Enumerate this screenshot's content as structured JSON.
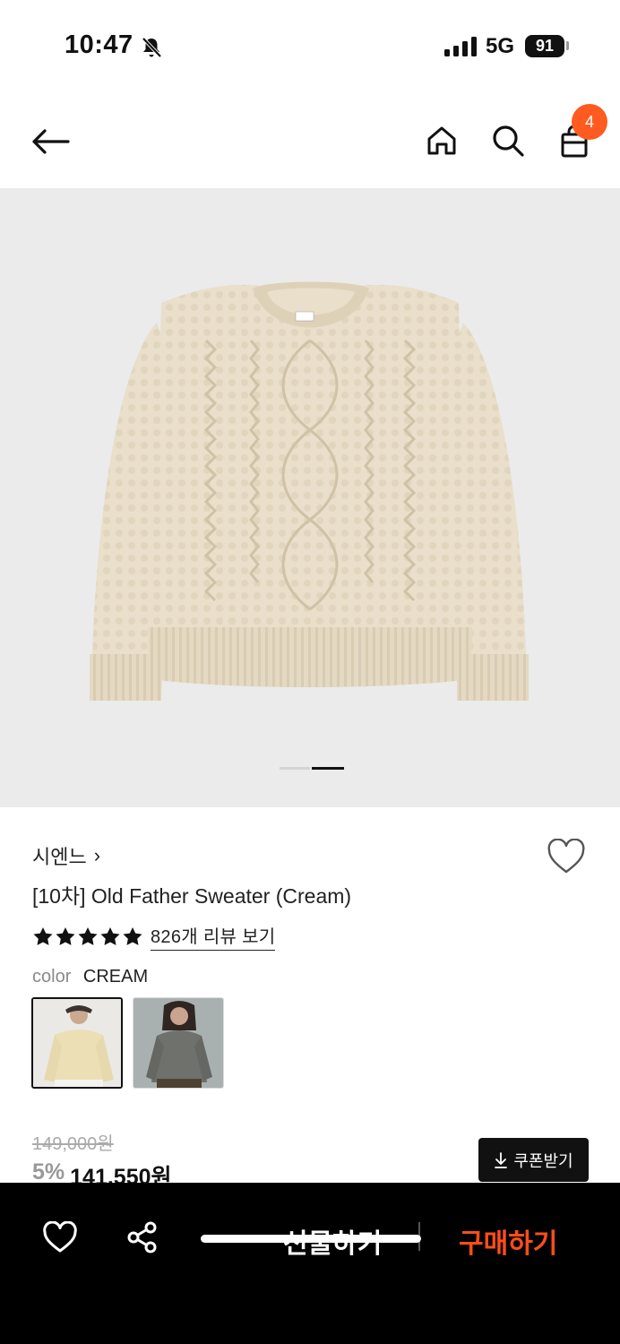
{
  "status_bar": {
    "time": "10:47",
    "network": "5G",
    "battery": "91"
  },
  "header": {
    "cart_count": "4"
  },
  "product": {
    "brand": "시엔느",
    "brand_chevron": "›",
    "title": "[10차] Old Father Sweater (Cream)",
    "rating_stars": 5,
    "reviews_link": "826개 리뷰 보기",
    "color_label": "color",
    "color_value": "CREAM",
    "original_price": "149,000원",
    "discount": "5%",
    "sale_price": "141,550원",
    "coupon_button": "쿠폰받기"
  },
  "carousel": {
    "slides": 2,
    "active": 2
  },
  "bottom_bar": {
    "gift_label": "선물하기",
    "buy_label": "구매하기"
  },
  "colors": {
    "accent": "#ff5a1f",
    "buy": "#ff4d1a",
    "sweater": "#e9dfca",
    "gray_sweater": "#6e716c"
  }
}
